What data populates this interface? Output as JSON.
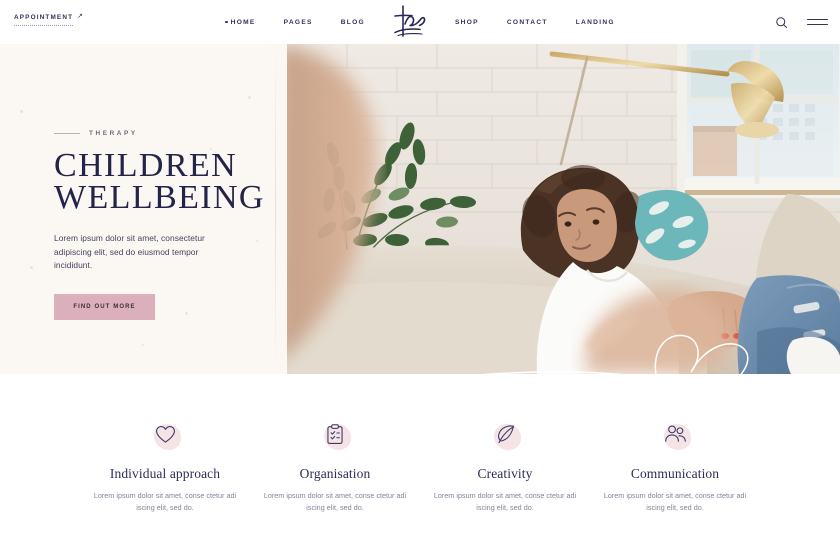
{
  "header": {
    "appointment": {
      "label": "APPOINTMENT",
      "arrow": "↗"
    },
    "nav_left": [
      {
        "label": "HOME",
        "active": true
      },
      {
        "label": "PAGES",
        "active": false
      },
      {
        "label": "BLOG",
        "active": false
      }
    ],
    "nav_right": [
      {
        "label": "SHOP",
        "active": false
      },
      {
        "label": "CONTACT",
        "active": false
      },
      {
        "label": "LANDING",
        "active": false
      }
    ],
    "logo_name": "brand-signature-logo",
    "search_icon": "search-icon",
    "menu_icon": "hamburger-menu-icon"
  },
  "hero": {
    "eyebrow": "THERAPY",
    "title_line1": "CHILDREN",
    "title_line2": "WELLBEING",
    "subtitle": "Lorem ipsum dolor sit amet, consectetur adipiscing elit, sed do eiusmod tempor incididunt.",
    "button_label": "FIND OUT MORE",
    "image_alt": "Woman relaxing on a couch by a window with plant and brass lamp",
    "background_color": "#fbf7f3",
    "button_color": "#dcafbd"
  },
  "features": [
    {
      "icon": "heart-icon",
      "title": "Individual approach",
      "text": "Lorem ipsum dolor sit amet, conse ctetur adi iscing elit, sed do."
    },
    {
      "icon": "clipboard-checklist-icon",
      "title": "Organisation",
      "text": "Lorem ipsum dolor sit amet, conse ctetur adi iscing elit, sed do."
    },
    {
      "icon": "feather-quill-icon",
      "title": "Creativity",
      "text": "Lorem ipsum dolor sit amet, conse ctetur adi iscing elit, sed do."
    },
    {
      "icon": "people-group-icon",
      "title": "Communication",
      "text": "Lorem ipsum dolor sit amet, conse ctetur adi iscing elit, sed do."
    }
  ],
  "colors": {
    "navy": "#2d2d55",
    "pink": "#dcafbd",
    "cream": "#fbf7f3",
    "muted": "#82829a"
  }
}
